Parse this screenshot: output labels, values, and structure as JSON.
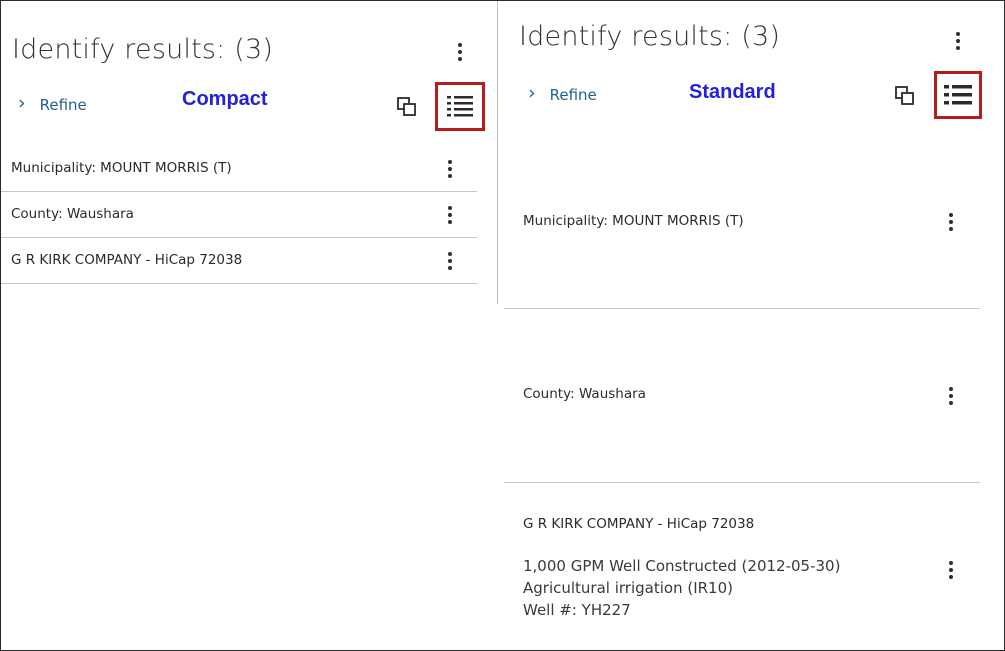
{
  "compact": {
    "title": "Identify results: (3)",
    "refine_label": "Refine",
    "mode_label": "Compact",
    "results": [
      {
        "label": "Municipality: MOUNT MORRIS (T)"
      },
      {
        "label": "County: Waushara"
      },
      {
        "label": "G R KIRK COMPANY - HiCap 72038"
      }
    ]
  },
  "standard": {
    "title": "Identify results: (3)",
    "refine_label": "Refine",
    "mode_label": "Standard",
    "results": [
      {
        "label": "Municipality: MOUNT MORRIS (T)"
      },
      {
        "label": "County: Waushara"
      },
      {
        "label": "G R KIRK COMPANY - HiCap 72038",
        "details": [
          "1,000 GPM Well Constructed (2012-05-30)",
          "Agricultural irrigation (IR10)",
          "Well #:  YH227"
        ]
      }
    ]
  },
  "colors": {
    "accent_link": "#1f5f8f",
    "mode_label": "#2222dd",
    "highlight_border": "#b61c1c"
  },
  "icons": {
    "expand": "chevron-right-icon",
    "copy": "copy-icon",
    "list_view": "list-view-icon",
    "more": "more-vertical-icon"
  }
}
